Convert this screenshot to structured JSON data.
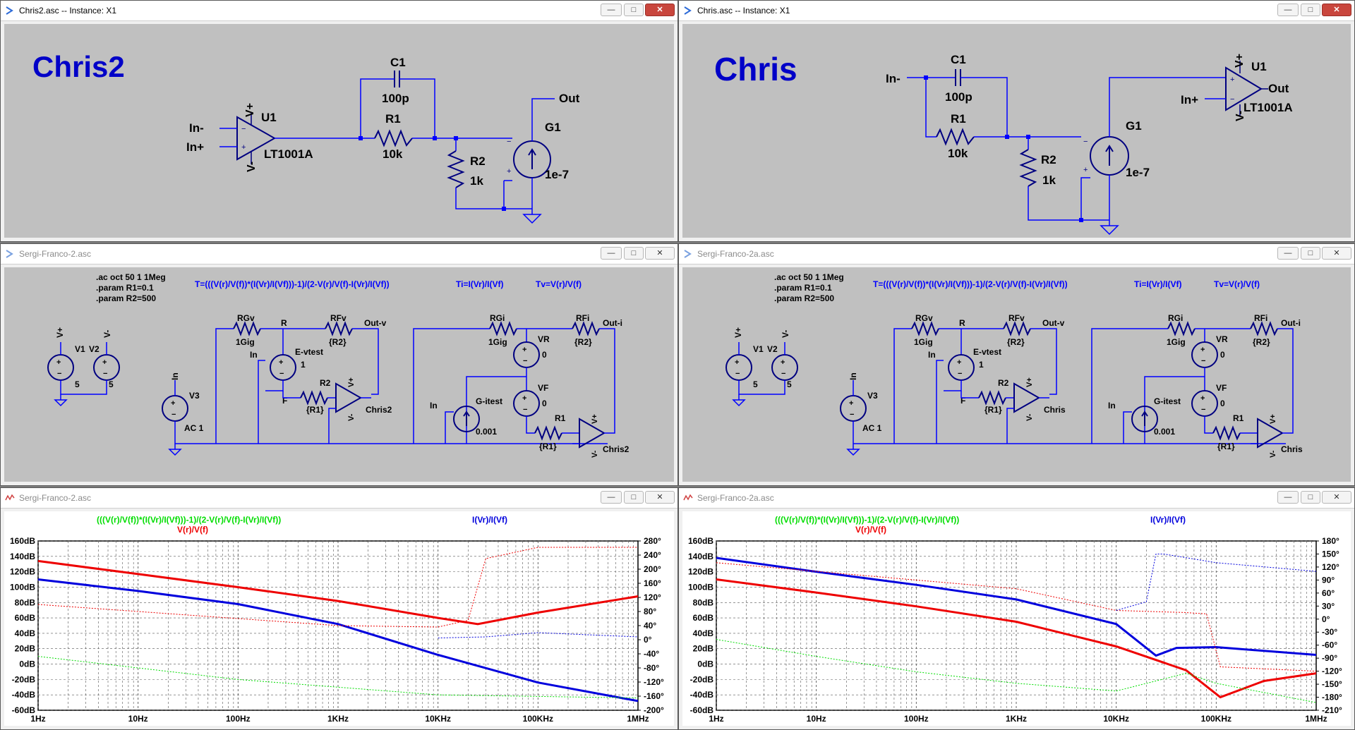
{
  "windows": {
    "w1": {
      "title": "Chris2.asc -- Instance: X1"
    },
    "w2": {
      "title": "Chris.asc -- Instance: X1"
    },
    "w3": {
      "title": "Sergi-Franco-2.asc"
    },
    "w4": {
      "title": "Sergi-Franco-2a.asc"
    },
    "w5": {
      "title": "Sergi-Franco-2.asc"
    },
    "w6": {
      "title": "Sergi-Franco-2a.asc"
    }
  },
  "buttons": {
    "min": "—",
    "max": "□",
    "close": "✕"
  },
  "chris2": {
    "title": "Chris2",
    "c1": "C1",
    "c1_val": "100p",
    "r1": "R1",
    "r1_val": "10k",
    "u1": "U1",
    "u1_part": "LT1001A",
    "vplus": "V+",
    "vminus": "V-",
    "in_minus": "In-",
    "in_plus": "In+",
    "r2": "R2",
    "r2_val": "1k",
    "g1": "G1",
    "g1_val": "1e-7",
    "out": "Out"
  },
  "chris": {
    "title": "Chris",
    "c1": "C1",
    "c1_val": "100p",
    "r1": "R1",
    "r1_val": "10k",
    "u1": "U1",
    "u1_part": "LT1001A",
    "vplus": "V+",
    "vminus": "V-",
    "in_minus": "In-",
    "in_plus": "In+",
    "r2": "R2",
    "r2_val": "1k",
    "g1": "G1",
    "g1_val": "1e-7",
    "out": "Out"
  },
  "sf_left": {
    "dir1": ".ac oct 50 1 1Meg",
    "dir2": ".param R1=0.1",
    "dir3": ".param R2=500",
    "eq_T": "T=(((V(r)/V(f))*(I(Vr)/I(Vf)))-1)/(2-V(r)/V(f)-I(Vr)/I(Vf))",
    "eq_Ti": "Ti=I(Vr)/I(Vf)",
    "eq_Tv": "Tv=V(r)/V(f)",
    "v1": "V1",
    "v2": "V2",
    "vplus": "V+",
    "vminus": "V-",
    "v1_val": "5",
    "v2_val": "5",
    "v3": "V3",
    "v3_val": "AC 1",
    "in": "In",
    "rgv": "RGv",
    "rgv_val": "1Gig",
    "r_node": "R",
    "rfv": "RFv",
    "rfv_val": "{R2}",
    "outv": "Out-v",
    "evtest": "E-vtest",
    "evtest_val": "1",
    "f_node": "F",
    "r2": "R2",
    "r2_val": "{R1}",
    "opamp": "Chris2",
    "rgi": "RGi",
    "rgi_val": "1Gig",
    "vr": "VR",
    "vr_val": "0",
    "rfi": "RFi",
    "rfi_val": "{R2}",
    "outi": "Out-i",
    "vf": "VF",
    "vf_val": "0",
    "gitest": "G-itest",
    "gitest_val": "0.001",
    "r1": "R1",
    "r1_val": "{R1}"
  },
  "sf_right": {
    "dir1": ".ac oct 50 1 1Meg",
    "dir2": ".param R1=0.1",
    "dir3": ".param R2=500",
    "eq_T": "T=(((V(r)/V(f))*(I(Vr)/I(Vf)))-1)/(2-V(r)/V(f)-I(Vr)/I(Vf))",
    "eq_Ti": "Ti=I(Vr)/I(Vf)",
    "eq_Tv": "Tv=V(r)/V(f)",
    "v1": "V1",
    "v2": "V2",
    "vplus": "V+",
    "vminus": "V-",
    "v1_val": "5",
    "v2_val": "5",
    "v3": "V3",
    "v3_val": "AC 1",
    "in": "In",
    "rgv": "RGv",
    "rgv_val": "1Gig",
    "r_node": "R",
    "rfv": "RFv",
    "rfv_val": "{R2}",
    "outv": "Out-v",
    "evtest": "E-vtest",
    "evtest_val": "1",
    "f_node": "F",
    "r2": "R2",
    "r2_val": "{R1}",
    "opamp": "Chris",
    "rgi": "RGi",
    "rgi_val": "1Gig",
    "vr": "VR",
    "vr_val": "0",
    "rfi": "RFi",
    "rfi_val": "{R2}",
    "outi": "Out-i",
    "vf": "VF",
    "vf_val": "0",
    "gitest": "G-itest",
    "gitest_val": "0.001",
    "r1": "R1",
    "r1_val": "{R1}"
  },
  "plot_left": {
    "trace_green": "(((V(r)/V(f))*(I(Vr)/I(Vf)))-1)/(2-V(r)/V(f)-I(Vr)/I(Vf))",
    "trace_red": "V(r)/V(f)",
    "trace_blue": "I(Vr)/I(Vf)"
  },
  "plot_right": {
    "trace_green": "(((V(r)/V(f))*(I(Vr)/I(Vf)))-1)/(2-V(r)/V(f)-I(Vr)/I(Vf))",
    "trace_red": "V(r)/V(f)",
    "trace_blue": "I(Vr)/I(Vf)"
  },
  "colors": {
    "net": "#0000ff",
    "component": "#000080",
    "title": "#0000c8",
    "green": "#00dd00",
    "red": "#ee0000",
    "blue": "#0000dd"
  },
  "chart_data": [
    {
      "type": "line",
      "x_label": "",
      "x_ticks": [
        "1Hz",
        "10Hz",
        "100Hz",
        "1KHz",
        "10KHz",
        "100KHz",
        "1MHz"
      ],
      "xlim": [
        1,
        1000000
      ],
      "x_scale": "log",
      "y_ticks": [
        "160dB",
        "140dB",
        "120dB",
        "100dB",
        "80dB",
        "60dB",
        "40dB",
        "20dB",
        "0dB",
        "-20dB",
        "-40dB",
        "-60dB"
      ],
      "ylim": [
        -60,
        160
      ],
      "y2_ticks": [
        "280°",
        "240°",
        "200°",
        "160°",
        "120°",
        "80°",
        "40°",
        "0°",
        "-40°",
        "-80°",
        "-120°",
        "-160°",
        "-200°"
      ],
      "y2lim": [
        -200,
        280
      ],
      "grid": true,
      "series": [
        {
          "name": "V(r)/V(f)",
          "color": "#ee0000",
          "kind": "magnitude",
          "x": [
            1,
            10,
            100,
            1000,
            10000,
            25000,
            100000,
            1000000
          ],
          "y": [
            134,
            117,
            100,
            82,
            60,
            52,
            67,
            88
          ]
        },
        {
          "name": "I(Vr)/I(Vf)",
          "color": "#0000dd",
          "kind": "magnitude",
          "x": [
            1,
            10,
            100,
            1000,
            10000,
            100000,
            1000000
          ],
          "y": [
            110,
            95,
            78,
            52,
            12,
            -24,
            -48
          ]
        },
        {
          "name": "(((V(r)/V(f))*(I(Vr)/I(Vf)))-1)/(2-V(r)/V(f)-I(Vr)/I(Vf))",
          "color": "#00dd00",
          "kind": "magnitude",
          "x": [
            1,
            10,
            100,
            1000,
            10000,
            100000,
            1000000
          ],
          "y": [
            10,
            -5,
            -20,
            -30,
            -40,
            -42,
            -44
          ]
        },
        {
          "name": "V(r)/V(f) phase",
          "color": "#ee0000",
          "kind": "phase",
          "x": [
            1,
            10,
            100,
            1000,
            10000,
            20000,
            30000,
            100000,
            1000000
          ],
          "y": [
            100,
            80,
            60,
            40,
            36,
            55,
            230,
            262,
            262
          ]
        },
        {
          "name": "I(Vr)/I(Vf) phase",
          "color": "#0000dd",
          "kind": "phase",
          "x": [
            10000,
            30000,
            100000,
            1000000
          ],
          "y": [
            5,
            8,
            20,
            8
          ]
        }
      ]
    },
    {
      "type": "line",
      "x_label": "",
      "x_ticks": [
        "1Hz",
        "10Hz",
        "100Hz",
        "1KHz",
        "10KHz",
        "100KHz",
        "1MHz"
      ],
      "xlim": [
        1,
        1000000
      ],
      "x_scale": "log",
      "y_ticks": [
        "160dB",
        "140dB",
        "120dB",
        "100dB",
        "80dB",
        "60dB",
        "40dB",
        "20dB",
        "0dB",
        "-20dB",
        "-40dB",
        "-60dB"
      ],
      "ylim": [
        -60,
        160
      ],
      "y2_ticks": [
        "180°",
        "150°",
        "120°",
        "90°",
        "60°",
        "30°",
        "0°",
        "-30°",
        "-60°",
        "-90°",
        "-120°",
        "-150°",
        "-180°",
        "-210°"
      ],
      "y2lim": [
        -210,
        180
      ],
      "grid": true,
      "series": [
        {
          "name": "I(Vr)/I(Vf)",
          "color": "#0000dd",
          "kind": "magnitude",
          "x": [
            1,
            10,
            100,
            1000,
            10000,
            25000,
            40000,
            100000,
            1000000
          ],
          "y": [
            138,
            120,
            103,
            84,
            52,
            11,
            21,
            22,
            12
          ]
        },
        {
          "name": "V(r)/V(f)",
          "color": "#ee0000",
          "kind": "magnitude",
          "x": [
            1,
            10,
            100,
            1000,
            10000,
            50000,
            110000,
            300000,
            1000000
          ],
          "y": [
            110,
            93,
            75,
            55,
            23,
            -8,
            -43,
            -22,
            -12
          ]
        },
        {
          "name": "(((V(r)/V(f))*(I(Vr)/I(Vf)))-1)/(2-V(r)/V(f)-I(Vr)/I(Vf))",
          "color": "#00dd00",
          "kind": "magnitude",
          "x": [
            1,
            10,
            100,
            1000,
            10000,
            50000,
            100000,
            1000000
          ],
          "y": [
            32,
            10,
            -10,
            -25,
            -35,
            -12,
            -25,
            -50
          ]
        },
        {
          "name": "V(r)/V(f) phase",
          "color": "#ee0000",
          "kind": "phase",
          "x": [
            1,
            10,
            100,
            1000,
            10000,
            50000,
            80000,
            110000,
            1000000
          ],
          "y": [
            130,
            110,
            90,
            70,
            20,
            15,
            12,
            -110,
            -120
          ]
        },
        {
          "name": "I(Vr)/I(Vf) phase",
          "color": "#0000dd",
          "kind": "phase",
          "x": [
            10000,
            20000,
            25000,
            30000,
            100000,
            1000000
          ],
          "y": [
            20,
            40,
            150,
            150,
            130,
            110
          ]
        }
      ]
    }
  ]
}
